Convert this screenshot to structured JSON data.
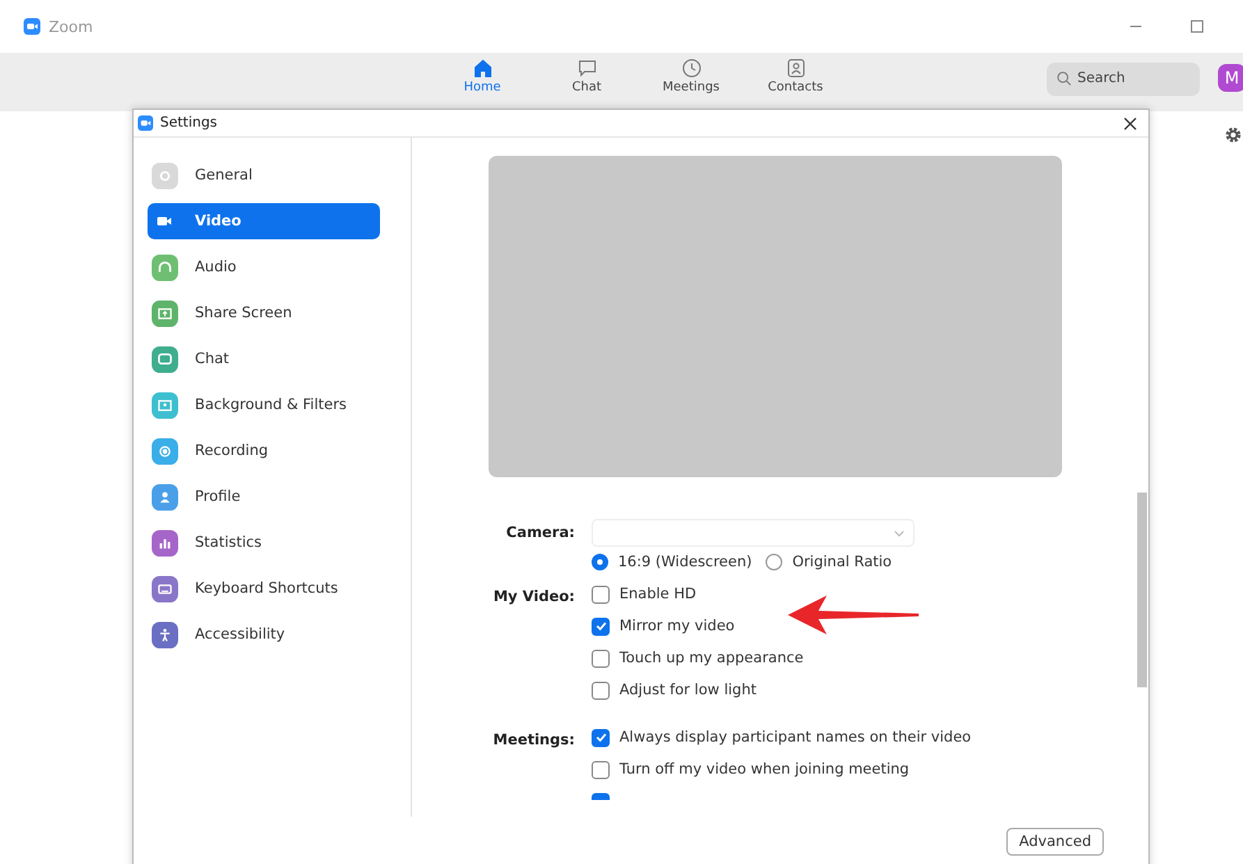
{
  "app": {
    "title": "Zoom"
  },
  "nav_tabs": [
    {
      "label": "Home",
      "kind": "home",
      "selected": true
    },
    {
      "label": "Chat",
      "kind": "chat",
      "selected": false
    },
    {
      "label": "Meetings",
      "kind": "clock",
      "selected": false
    },
    {
      "label": "Contacts",
      "kind": "contact",
      "selected": false
    }
  ],
  "search": {
    "placeholder": "Search"
  },
  "avatar": {
    "initial": "M"
  },
  "settings": {
    "title": "Settings",
    "sidebar": [
      {
        "label": "General",
        "kind": "gear",
        "color": "#d9d9d9",
        "selected": false
      },
      {
        "label": "Video",
        "kind": "camera",
        "selected": true
      },
      {
        "label": "Audio",
        "kind": "headphones",
        "color": "#6fbf73",
        "selected": false
      },
      {
        "label": "Share Screen",
        "kind": "screen",
        "color": "#5fb36a",
        "selected": false
      },
      {
        "label": "Chat",
        "kind": "bubble",
        "color": "#3fae8f",
        "selected": false
      },
      {
        "label": "Background & Filters",
        "kind": "image",
        "color": "#3ebfcf",
        "selected": false
      },
      {
        "label": "Recording",
        "kind": "record",
        "color": "#3aaee8",
        "selected": false
      },
      {
        "label": "Profile",
        "kind": "person",
        "color": "#4a9fe8",
        "selected": false
      },
      {
        "label": "Statistics",
        "kind": "bars",
        "color": "#a666c9",
        "selected": false
      },
      {
        "label": "Keyboard Shortcuts",
        "kind": "keyboard",
        "color": "#8a76c9",
        "selected": false
      },
      {
        "label": "Accessibility",
        "kind": "accessibility",
        "color": "#6a6fc4",
        "selected": false
      }
    ],
    "camera_label": "Camera:",
    "ratios": [
      {
        "label": "16:9 (Widescreen)",
        "selected": true
      },
      {
        "label": "Original Ratio",
        "selected": false
      }
    ],
    "sections": [
      {
        "label": "My Video:",
        "options": [
          {
            "label": "Enable HD",
            "checked": false
          },
          {
            "label": "Mirror my video",
            "checked": true
          },
          {
            "label": "Touch up my appearance",
            "checked": false
          },
          {
            "label": "Adjust for low light",
            "checked": false
          }
        ]
      },
      {
        "label": "Meetings:",
        "options": [
          {
            "label": "Always display participant names on their video",
            "checked": true
          },
          {
            "label": "Turn off my video when joining meeting",
            "checked": false
          },
          {
            "checked": true
          }
        ]
      }
    ],
    "advanced_button": "Advanced"
  }
}
